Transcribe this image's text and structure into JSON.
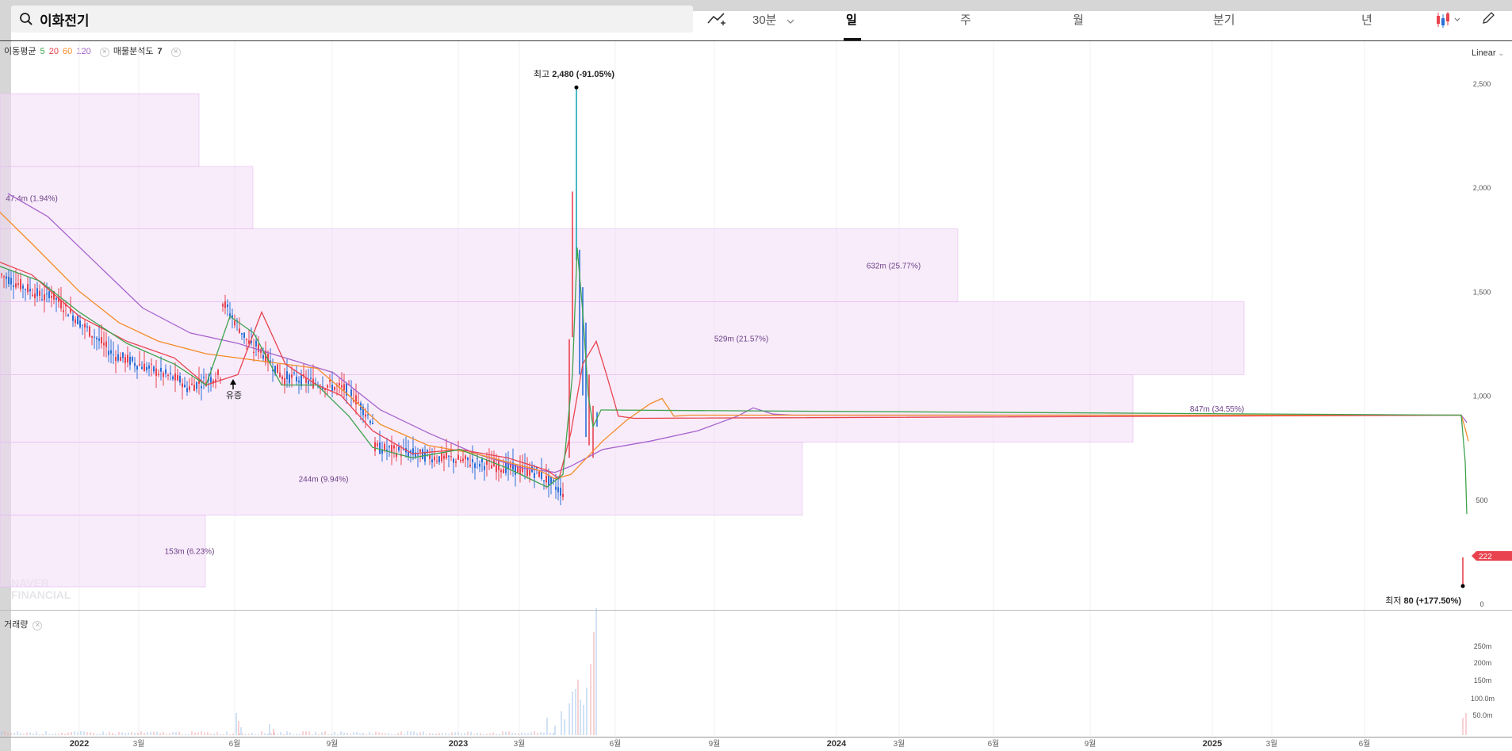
{
  "toolbar": {
    "search_value": "이화전기",
    "interval_30m": "30분",
    "tab_day": "일",
    "tab_week": "주",
    "tab_month": "월",
    "tab_quarter": "분기",
    "tab_year": "년"
  },
  "indicators": {
    "ma_label": "이동평균",
    "ma_periods": [
      "5",
      "20",
      "60",
      "120"
    ],
    "ma_colors": [
      "#3fa34d",
      "#e8434e",
      "#f28c28",
      "#a663cc"
    ],
    "vp_label": "매물분석도",
    "vp_value": "7"
  },
  "scale_label": "Linear",
  "volume_label": "거래량",
  "watermark": [
    "NAVER",
    "FINANCIAL"
  ],
  "chart_data": {
    "type": "line",
    "ylim": [
      0,
      2550
    ],
    "y_ticks": [
      "2,500",
      "2,000",
      "1,500",
      "1,000",
      "500",
      "0"
    ],
    "vol_ticks": [
      "250m",
      "200m",
      "150m",
      "100.0m",
      "50.0m"
    ],
    "x_tick_labels": [
      "2022",
      "3월",
      "6월",
      "9월",
      "2023",
      "3월",
      "6월",
      "9월",
      "2024",
      "3월",
      "6월",
      "9월",
      "2025",
      "3월",
      "6월"
    ],
    "high_label": "최고",
    "high_value": "2,480 (-91.05%)",
    "low_label": "최저",
    "low_value": "80 (+177.50%)",
    "current_price": "222",
    "event_label": "유증",
    "volume_profile": [
      {
        "label": "",
        "low": 2100,
        "high": 2450
      },
      {
        "label": "47.4m (1.94%)",
        "low": 1800,
        "high": 2100
      },
      {
        "label": "632m (25.77%)",
        "low": 1450,
        "high": 1800
      },
      {
        "label": "529m (21.57%)",
        "low": 1100,
        "high": 1450
      },
      {
        "label": "847m (34.55%)",
        "low": 775,
        "high": 1100
      },
      {
        "label": "244m (9.94%)",
        "low": 425,
        "high": 775
      },
      {
        "label": "153m (6.23%)",
        "low": 80,
        "high": 425
      }
    ],
    "series": [
      {
        "name": "5",
        "color": "#3fa34d"
      },
      {
        "name": "20",
        "color": "#e8434e"
      },
      {
        "name": "60",
        "color": "#f28c28"
      },
      {
        "name": "120",
        "color": "#a663cc"
      }
    ]
  }
}
